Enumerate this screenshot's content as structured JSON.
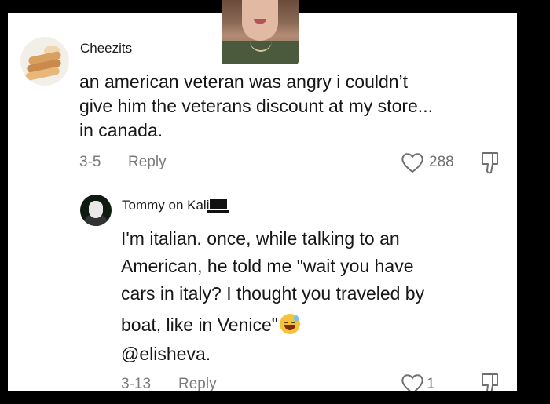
{
  "comments": [
    {
      "username": "Cheezits",
      "avatar": "bread-loaf-avatar",
      "text_lines": [
        "an american veteran was angry i couldn’t",
        "give him the veterans discount at my store...",
        "in canada."
      ],
      "date": "3-5",
      "reply_label": "Reply",
      "likes": "288"
    },
    {
      "username": "Tommy on Kali",
      "avatar": "masked-figure-avatar",
      "text_lines": [
        "I'm italian. once, while talking to an",
        "American, he told me \"wait you have",
        "cars in italy? I thought you traveled by",
        "boat, like in Venice\"",
        "@elisheva."
      ],
      "date": "3-13",
      "reply_label": "Reply",
      "likes": "1"
    }
  ],
  "icons": {
    "like": "heart-outline-icon",
    "dislike": "thumbs-down-outline-icon",
    "emoji": "grinning-face-with-sweat-emoji",
    "username_suffix": "laptop-emoji"
  },
  "colors": {
    "text": "#161616",
    "meta": "#7a7a7a",
    "background": "#ffffff",
    "frame": "#000000"
  }
}
